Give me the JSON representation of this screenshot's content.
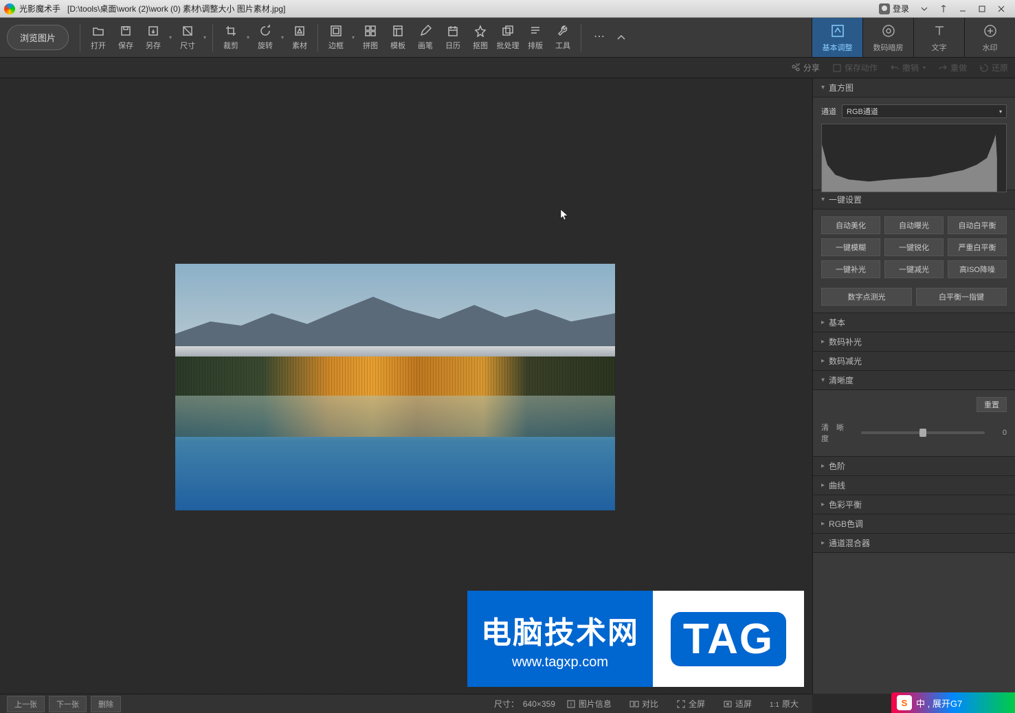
{
  "title": {
    "app": "光影魔术手",
    "path": "[D:\\tools\\桌面\\work (2)\\work (0) 素材\\调整大小 图片素材.jpg]",
    "login": "登录"
  },
  "toolbar": {
    "browse": "浏览图片",
    "items": [
      "打开",
      "保存",
      "另存",
      "尺寸",
      "裁剪",
      "旋转",
      "素材",
      "边框",
      "拼图",
      "模板",
      "画笔",
      "日历",
      "抠图",
      "批处理",
      "排版",
      "工具"
    ]
  },
  "rtabs": [
    "基本调整",
    "数码暗房",
    "文字",
    "水印"
  ],
  "subbar": {
    "share": "分享",
    "save_action": "保存动作",
    "undo": "撤销",
    "redo": "重做",
    "restore": "还原"
  },
  "panel": {
    "histogram": "直方图",
    "channel_label": "通道",
    "channel_value": "RGB通道",
    "presets": "一键设置",
    "preset_buttons": [
      "自动美化",
      "自动曝光",
      "自动白平衡",
      "一键模糊",
      "一键锐化",
      "严重白平衡",
      "一键补光",
      "一键减光",
      "高ISO降噪"
    ],
    "preset_row2": [
      "数字点测光",
      "白平衡一指键"
    ],
    "sections": [
      "基本",
      "数码补光",
      "数码减光",
      "清晰度",
      "色阶",
      "曲线",
      "色彩平衡",
      "RGB色调",
      "通道混合器"
    ],
    "clarity": {
      "label": "清 晰 度",
      "value": "0",
      "reset": "重置"
    }
  },
  "bottom": {
    "prev": "上一张",
    "next": "下一张",
    "delete": "删除",
    "size_label": "尺寸：",
    "size_value": "640×359",
    "info": "图片信息",
    "compare": "对比",
    "fullscreen": "全屏",
    "fit": "适屏",
    "original": "原大"
  },
  "watermark": {
    "line1": "电脑技术网",
    "line2": "www.tagxp.com",
    "tag": "TAG"
  },
  "ime": {
    "s": "S",
    "text": "中 ,  展开G7"
  }
}
